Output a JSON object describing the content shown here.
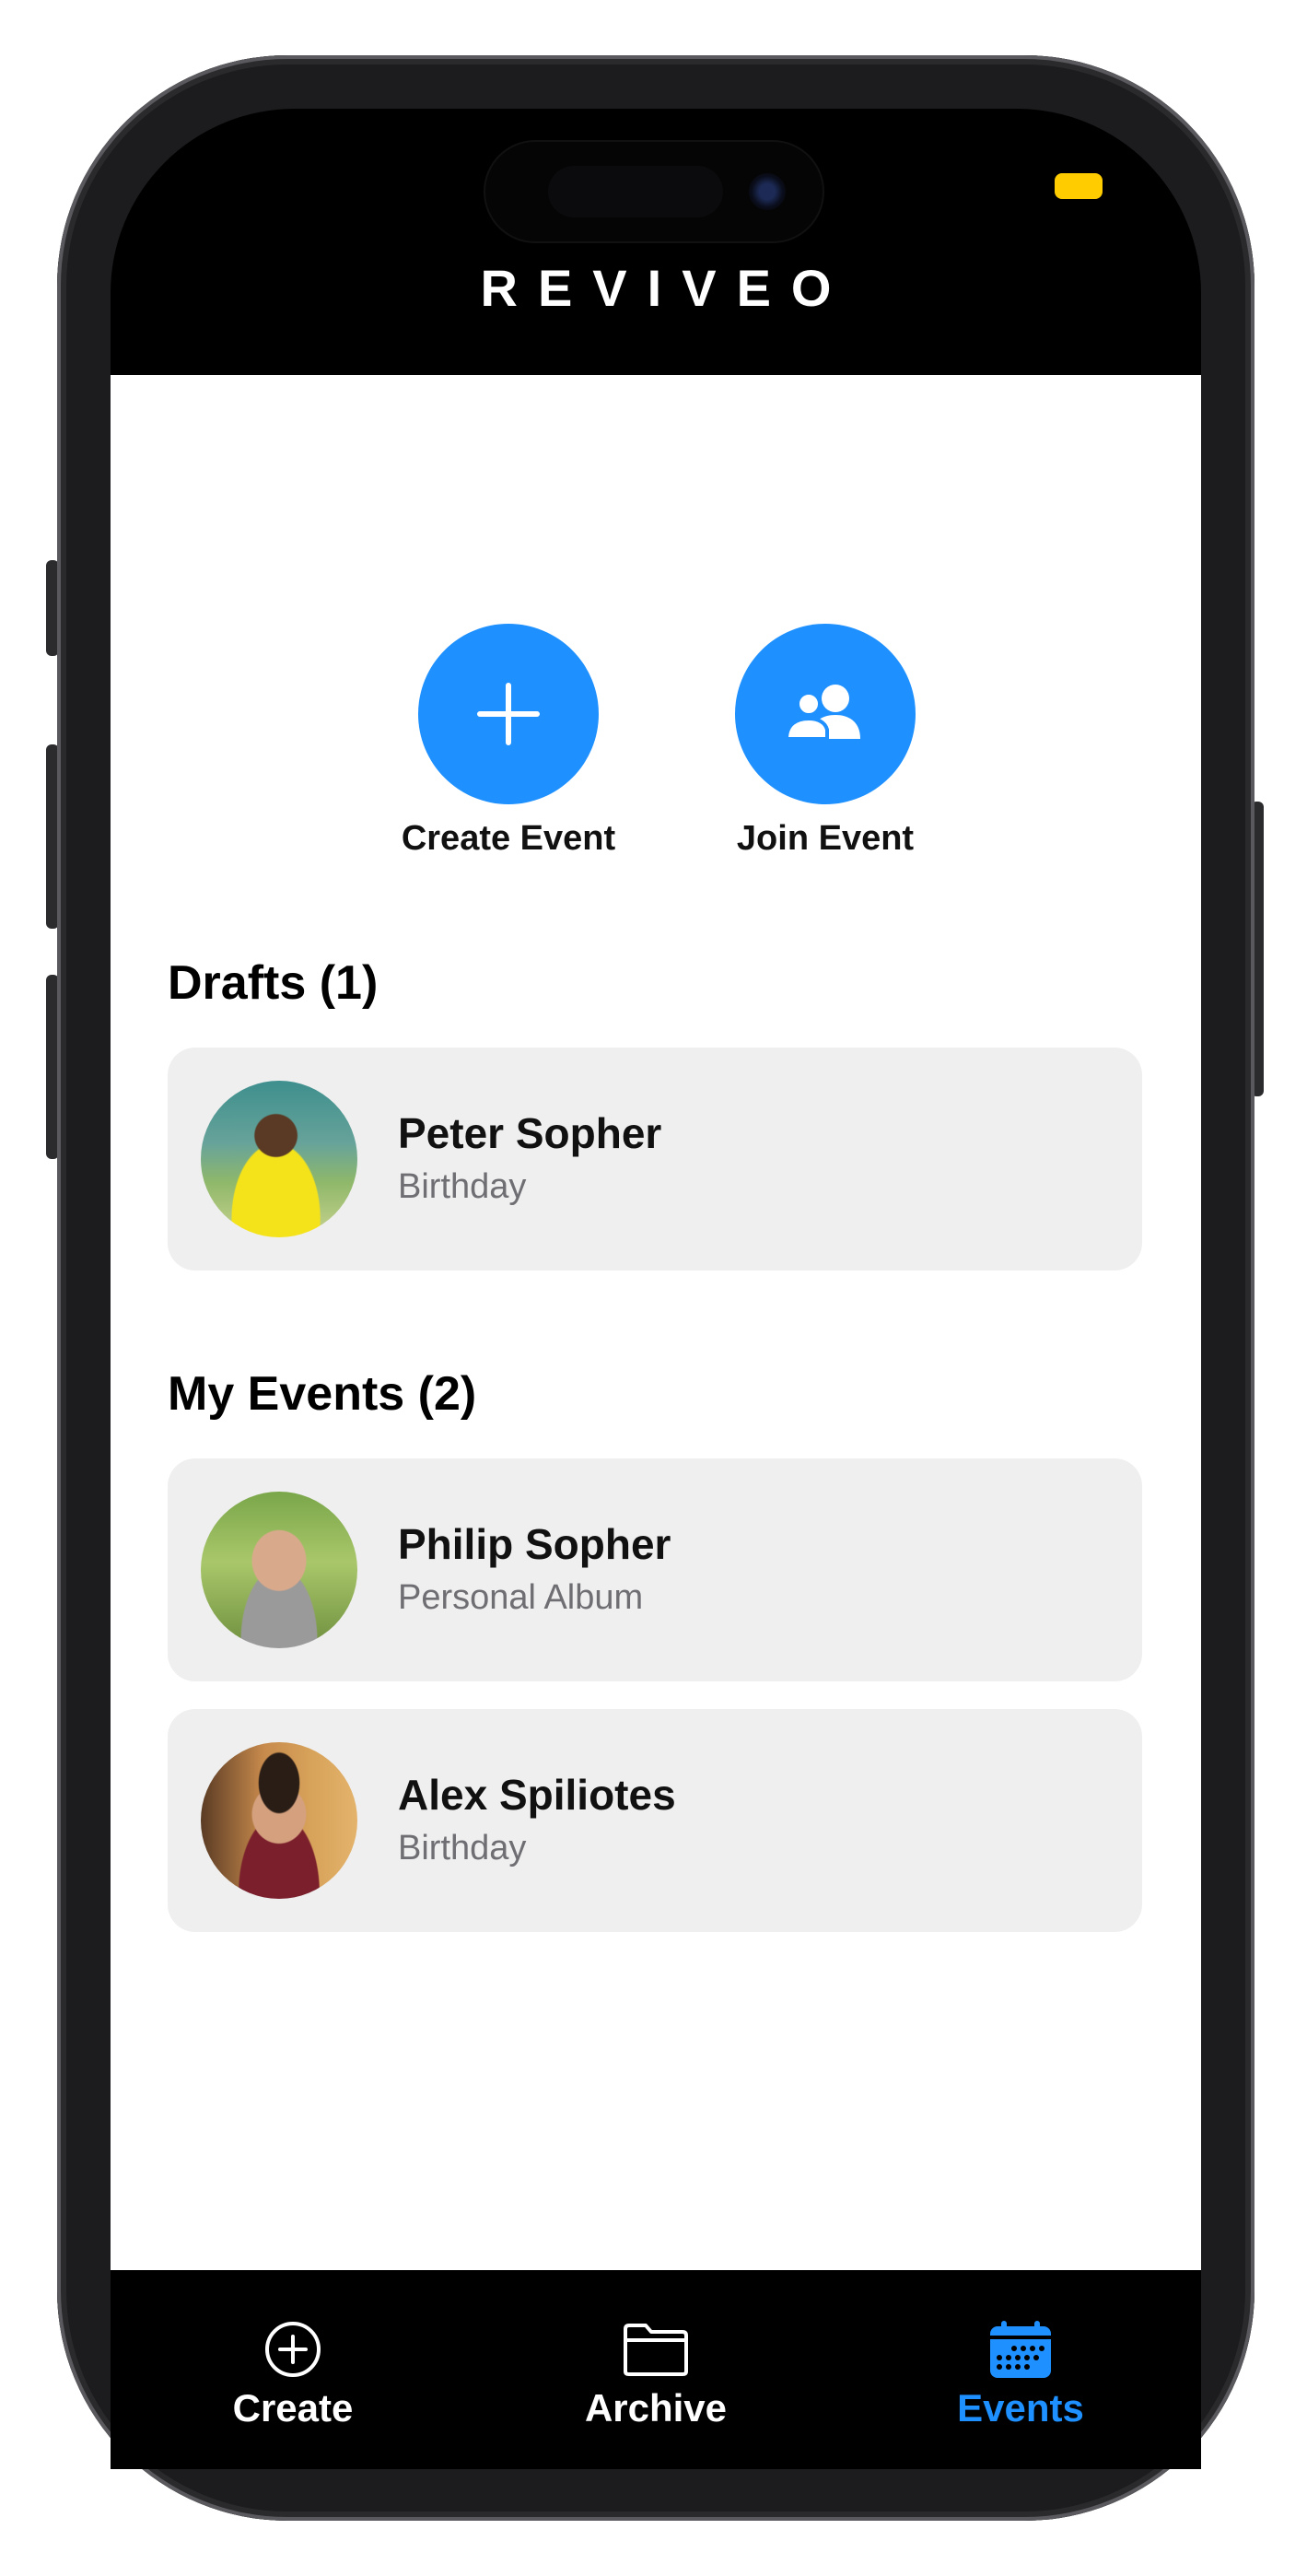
{
  "app": {
    "brand": "REVIVEO"
  },
  "actions": [
    {
      "label": "Create Event",
      "icon": "plus-icon"
    },
    {
      "label": "Join Event",
      "icon": "people-icon"
    }
  ],
  "drafts": {
    "title": "Drafts (1)",
    "items": [
      {
        "name": "Peter Sopher",
        "type": "Birthday",
        "avatar": "avatar-photo-boy"
      }
    ]
  },
  "my_events": {
    "title": "My Events (2)",
    "items": [
      {
        "name": "Philip Sopher",
        "type": "Personal Album",
        "avatar": "avatar-photo-man-bald"
      },
      {
        "name": "Alex Spiliotes",
        "type": "Birthday",
        "avatar": "avatar-photo-man-dark-hair"
      }
    ]
  },
  "tabbar": {
    "items": [
      {
        "label": "Create",
        "icon": "plus-circle-icon",
        "active": false
      },
      {
        "label": "Archive",
        "icon": "folder-icon",
        "active": false
      },
      {
        "label": "Events",
        "icon": "calendar-icon",
        "active": true
      }
    ]
  },
  "colors": {
    "accent": "#1e90ff",
    "card_bg": "#efefef",
    "status_indicator": "#ffcc00"
  }
}
